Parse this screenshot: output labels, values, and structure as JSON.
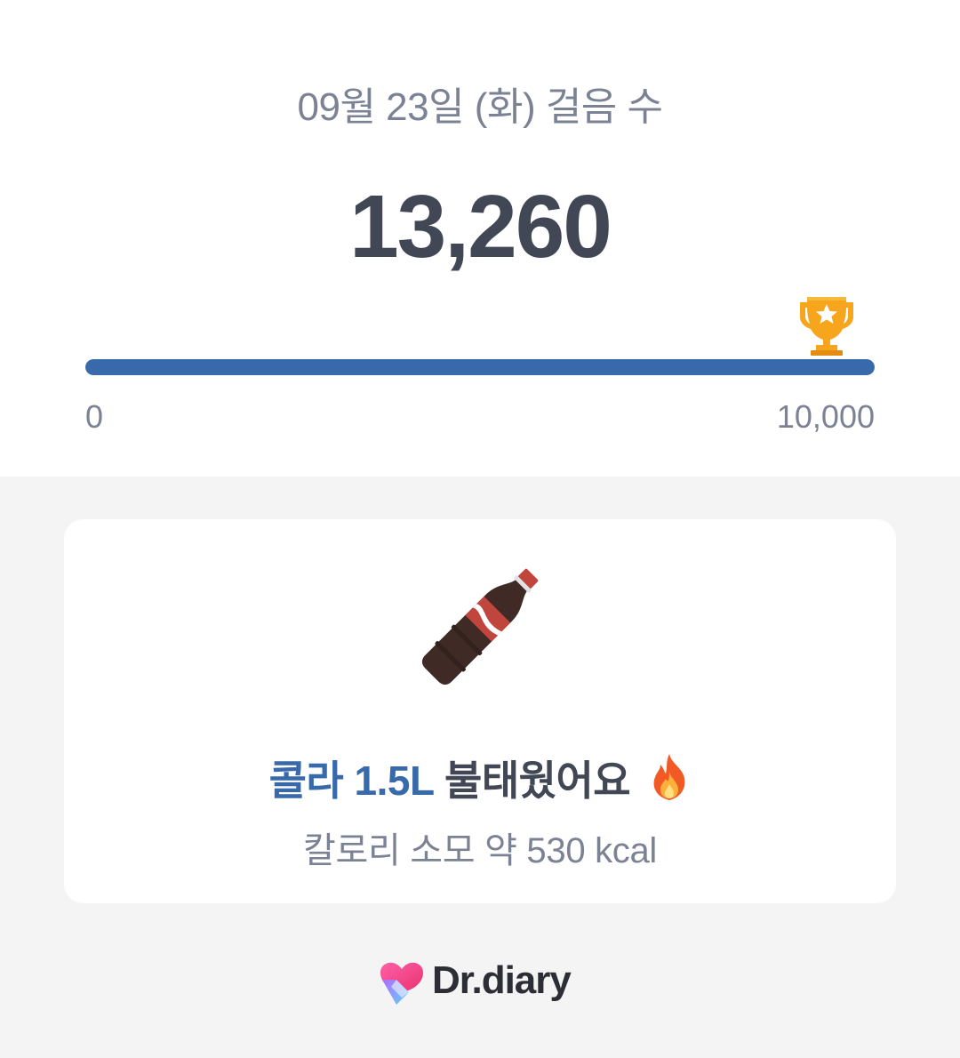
{
  "header": {
    "title": "09월 23일 (화) 걸음 수",
    "step_count": "13,260"
  },
  "progress": {
    "min_label": "0",
    "goal_label": "10,000",
    "fraction": 1.0,
    "goal_icon": "trophy-icon",
    "fill_color": "#3869aa"
  },
  "card": {
    "illustration": "cola-bottle-icon",
    "headline_accent": "콜라 1.5L",
    "headline_rest": "불태웠어요",
    "headline_icon": "fire-icon",
    "subline": "칼로리 소모 약 530 kcal"
  },
  "brand": {
    "name": "Dr.diary",
    "logo": "heart-logo-icon"
  },
  "colors": {
    "accent": "#3869aa",
    "text_dark": "#414755",
    "text_muted": "#7b8294",
    "background": "#f4f4f4"
  }
}
